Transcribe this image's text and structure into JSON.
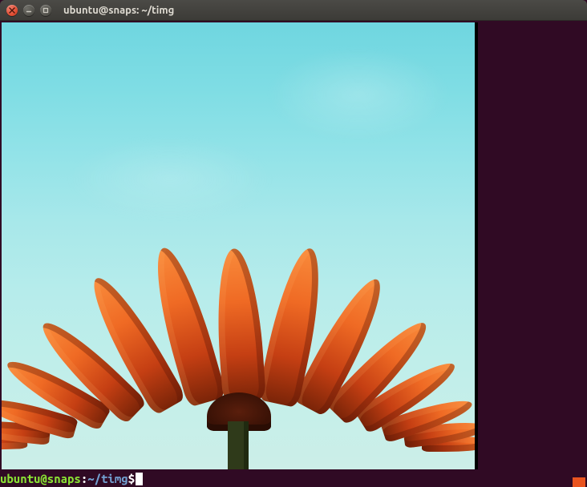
{
  "window": {
    "title": "ubuntu@snaps: ~/timg"
  },
  "prompt": {
    "user_host": "ubuntu@snaps",
    "separator": ":",
    "path": "~/timg",
    "symbol": "$"
  },
  "colors": {
    "terminal_bg": "#300a24",
    "prompt_user": "#8ae234",
    "prompt_path": "#729fcf",
    "accent": "#e95420"
  },
  "image_output": {
    "description": "pixelated-flower-on-sky",
    "subject": "orange-daisy",
    "background": "cyan-sky"
  }
}
